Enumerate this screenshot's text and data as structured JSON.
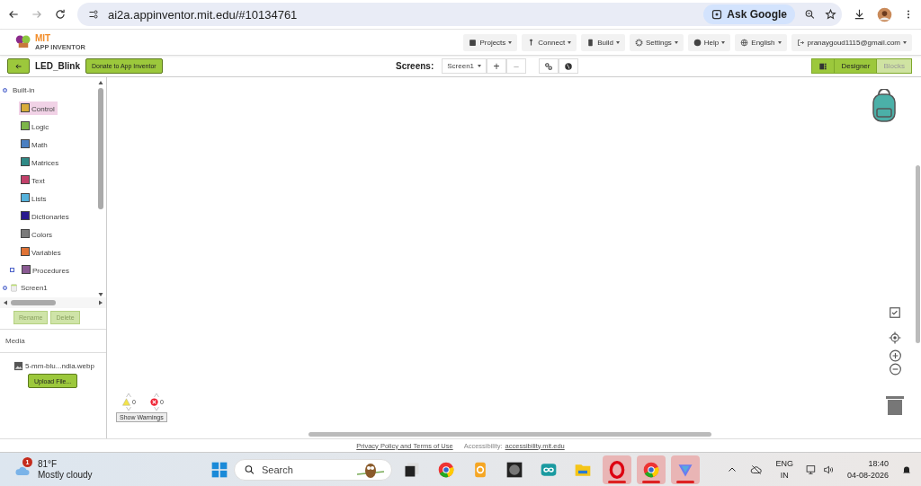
{
  "browser": {
    "url": "ai2a.appinventor.mit.edu/#10134761",
    "ask_button": "Ask Google"
  },
  "app": {
    "logo_title": "MIT",
    "logo_subtitle": "APP INVENTOR",
    "menu": [
      {
        "kind": "projects",
        "label": "Projects"
      },
      {
        "kind": "connect",
        "label": "Connect"
      },
      {
        "kind": "build",
        "label": "Build"
      },
      {
        "kind": "settings",
        "label": "Settings"
      },
      {
        "kind": "help",
        "label": "Help"
      },
      {
        "kind": "language",
        "label": "English"
      },
      {
        "kind": "account",
        "label": "pranaygoud1115@gmail.com"
      }
    ]
  },
  "toolbar": {
    "project": "LED_Blink",
    "donate": "Donate to App Inventor",
    "screens_label": "Screens:",
    "screen": "Screen1",
    "add": "+",
    "remove": "−",
    "layout_toggle": {
      "on": true
    },
    "views": [
      {
        "label": "Designer",
        "selected": true
      },
      {
        "label": "Blocks",
        "selected": false
      }
    ]
  },
  "blocks_tree": {
    "label": "Built-in",
    "expanded": true,
    "children": [
      {
        "label": "Control",
        "color": "#d9ac3b",
        "selected": true
      },
      {
        "label": "Logic",
        "color": "#7db54a",
        "selected": false
      },
      {
        "label": "Math",
        "color": "#4a7fc1",
        "selected": false
      },
      {
        "label": "Matrices",
        "color": "#2f8a86",
        "selected": false
      },
      {
        "label": "Text",
        "color": "#c2406a",
        "selected": false
      },
      {
        "label": "Lists",
        "color": "#55b2dc",
        "selected": false
      },
      {
        "label": "Dictionaries",
        "color": "#2a1a8f",
        "selected": false
      },
      {
        "label": "Colors",
        "color": "#7a7a7a",
        "selected": false
      },
      {
        "label": "Variables",
        "color": "#e07336",
        "selected": false
      },
      {
        "label": "Procedures",
        "color": "#8a5a93",
        "selected": false,
        "expandable": true
      }
    ]
  },
  "screen_node": {
    "label": "Screen1",
    "expanded": true
  },
  "panel_buttons": [
    {
      "label": "Rename",
      "disabled": true
    },
    {
      "label": "Delete",
      "disabled": true
    }
  ],
  "media": {
    "title": "Media",
    "files": [
      "5-mm-blu...ndia.webp"
    ],
    "upload": "Upload File..."
  },
  "workspace": {
    "warnings": "0",
    "errors": "0",
    "show_warnings": "Show Warnings"
  },
  "footer": {
    "privacy": "Privacy Policy and Terms of Use",
    "accessibility_label": "Accessibility:",
    "accessibility_link": "accessibility.mit.edu"
  },
  "taskbar": {
    "weather_badge": "1",
    "temperature": "81°F",
    "condition": "Mostly cloudy",
    "search": "Search",
    "apps": [
      {
        "kind": "files-dark",
        "open": false
      },
      {
        "kind": "chrome",
        "open": false
      },
      {
        "kind": "wallet",
        "open": false
      },
      {
        "kind": "photo",
        "open": false
      },
      {
        "kind": "arduino",
        "open": false
      },
      {
        "kind": "folder",
        "open": false
      },
      {
        "kind": "opera",
        "open": true
      },
      {
        "kind": "chrome-profile",
        "open": true
      },
      {
        "kind": "vpn",
        "open": true
      }
    ],
    "language_top": "ENG",
    "language_bottom": "IN",
    "time": "18:40",
    "date": "04-08-2026"
  }
}
